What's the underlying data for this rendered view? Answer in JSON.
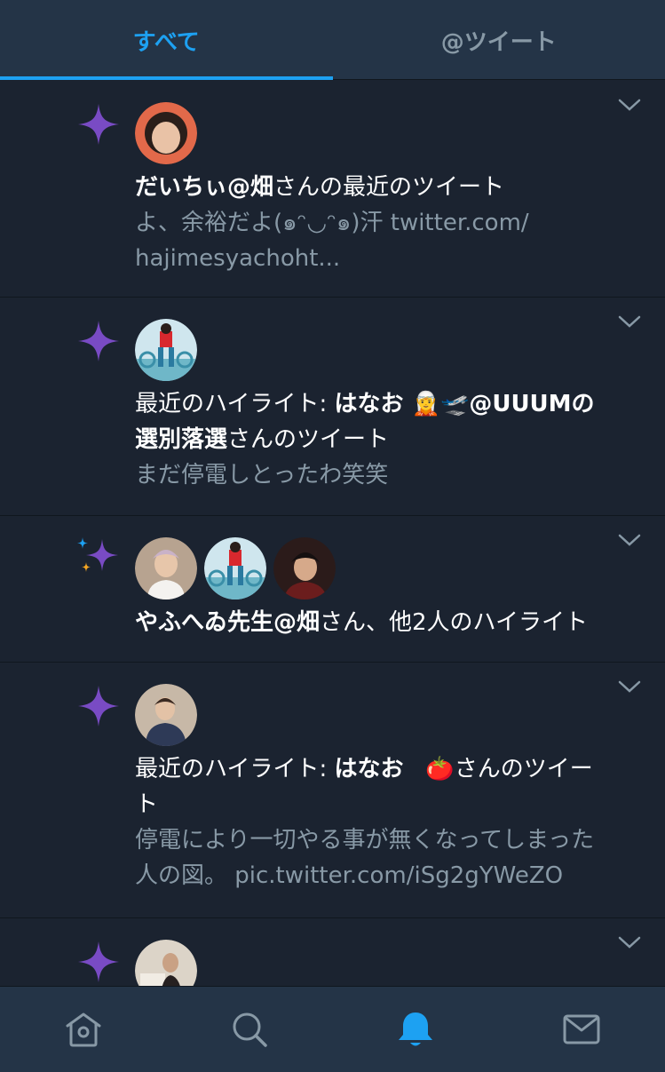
{
  "tabs": {
    "all": "すべて",
    "mentions": "@ツイート"
  },
  "items": [
    {
      "name_bold": "だいちぃ@畑",
      "headline_rest": "さんの最近のツイート",
      "snippet_1": "よ、余裕だよ(๑ᵔ◡ᵔ๑)汗 twitter.com/",
      "snippet_2": "hajimesyachoht..."
    },
    {
      "prefix": "最近のハイライト: ",
      "name_bold_1": "はなお ",
      "emoji_1": "🧝",
      "emoji_2": "🛫",
      "name_bold_2": "@UUUMの",
      "name_bold_3": "選別落選",
      "headline_rest": "さんのツイート",
      "snippet": "まだ停電しとったわ笑笑"
    },
    {
      "name_bold": "やふへゐ先生@畑",
      "headline_rest": "さん、他2人のハイライト"
    },
    {
      "prefix": "最近のハイライト: ",
      "name_bold": "はなお",
      "emoji": "🍅",
      "headline_rest_1": "さんのツイー",
      "headline_rest_2": "ト",
      "snippet_1": "停電により一切やる事が無くなってしまった",
      "snippet_2": "人の図。 pic.twitter.com/iSg2gYWeZO"
    }
  ],
  "colors": {
    "accent": "#1da1f2",
    "sparkle": "#794bc4",
    "background": "#1b2330",
    "muted_text": "#8899a6"
  },
  "icons": {
    "nav": [
      "home-icon",
      "search-icon",
      "notifications-icon",
      "messages-icon"
    ],
    "active_nav": "notifications-icon"
  }
}
